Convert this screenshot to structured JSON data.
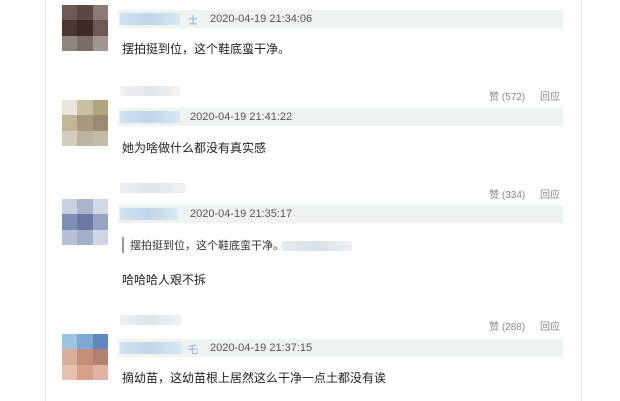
{
  "comments": [
    {
      "user_tail": "士",
      "timestamp": "2020-04-19 21:34:06",
      "text": "摆拍挺到位，这个鞋底蛮干净。",
      "avatar_colors": [
        "#6b5a55",
        "#5a4845",
        "#8a7b78",
        "#4a3632",
        "#3d2a27",
        "#6e5854",
        "#8f8480",
        "#7a6c69",
        "#a09592"
      ]
    },
    {
      "user_tail": "",
      "timestamp": "2020-04-19 21:41:22",
      "text": "她为啥做什么都没有真实感",
      "likes": "赞 (572)",
      "reply": "回应",
      "avatar_colors": [
        "#e8e6dc",
        "#c9c0a2",
        "#b3a47e",
        "#bfb69c",
        "#a89a80",
        "#9a8c72",
        "#d2cdbd",
        "#bcb4a0",
        "#c4bca8"
      ]
    },
    {
      "user_tail": "",
      "timestamp": "2020-04-19 21:35:17",
      "quote": "摆拍挺到位，这个鞋底蛮干净。",
      "text": "哈哈哈人艰不拆",
      "likes": "赞 (334)",
      "reply": "回应",
      "avatar_colors": [
        "#c9d0e0",
        "#a7b3cf",
        "#d2d8e6",
        "#7f8fb5",
        "#6c7aa3",
        "#97a3c2",
        "#b8c1d8",
        "#a3aec9",
        "#cfd5e3"
      ]
    },
    {
      "user_tail": "乇",
      "timestamp": "2020-04-19 21:37:15",
      "text": "摘幼苗，这幼苗根上居然这么干净一点土都没有诶",
      "likes": "赞 (288)",
      "reply": "回应",
      "avatar_colors": [
        "#9cc4e0",
        "#7ea9d4",
        "#5f88c0",
        "#d8b09a",
        "#c48f78",
        "#b3826e",
        "#e6bfae",
        "#d69f8c",
        "#e3b3a2"
      ]
    }
  ]
}
